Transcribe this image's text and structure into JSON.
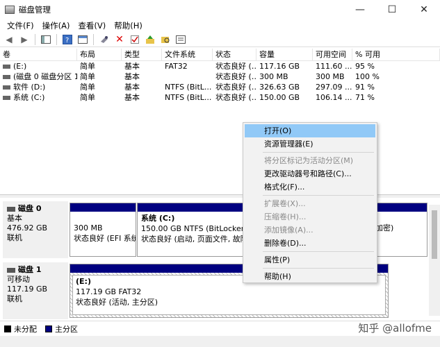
{
  "window": {
    "title": "磁盘管理",
    "min": "—",
    "max": "☐",
    "close": "✕"
  },
  "menu": [
    "文件(F)",
    "操作(A)",
    "查看(V)",
    "帮助(H)"
  ],
  "table": {
    "headers": [
      "卷",
      "布局",
      "类型",
      "文件系统",
      "状态",
      "容量",
      "可用空间",
      "% 可用"
    ],
    "rows": [
      [
        "(E:)",
        "简单",
        "基本",
        "FAT32",
        "状态良好 (…",
        "117.16 GB",
        "111.60 ...",
        "95 %"
      ],
      [
        "(磁盘 0 磁盘分区 1)",
        "简单",
        "基本",
        "",
        "状态良好 (…",
        "300 MB",
        "300 MB",
        "100 %"
      ],
      [
        "软件 (D:)",
        "简单",
        "基本",
        "NTFS (BitL...",
        "状态良好 (…",
        "326.63 GB",
        "297.09 ...",
        "91 %"
      ],
      [
        "系统 (C:)",
        "简单",
        "基本",
        "NTFS (BitL...",
        "状态良好 (…",
        "150.00 GB",
        "106.14 ...",
        "71 %"
      ]
    ]
  },
  "disks": [
    {
      "name": "磁盘 0",
      "type": "基本",
      "size": "476.92 GB",
      "status": "联机",
      "partitions": [
        {
          "line1": "300 MB",
          "line2": "状态良好 (EFI 系统"
        },
        {
          "line1": "系统  (C:)",
          "line2": "150.00 GB NTFS (BitLocker 已加",
          "line3": "状态良好 (启动, 页面文件, 故障转"
        },
        {
          "line1": "",
          "line2": "加密)",
          "line3": ""
        }
      ]
    },
    {
      "name": "磁盘 1",
      "type": "可移动",
      "size": "117.19 GB",
      "status": "联机",
      "partitions": [
        {
          "line1": "(E:)",
          "line2": "117.19 GB FAT32",
          "line3": "状态良好 (活动, 主分区)"
        }
      ]
    }
  ],
  "legend": {
    "unallocated": "未分配",
    "primary": "主分区",
    "unallocated_color": "#000000",
    "primary_color": "#000080"
  },
  "context_menu": {
    "items": [
      "打开(O)",
      "资源管理器(E)",
      "将分区标记为活动分区(M)",
      "更改驱动器号和路径(C)...",
      "格式化(F)...",
      "扩展卷(X)...",
      "压缩卷(H)...",
      "添加镜像(A)...",
      "删除卷(D)...",
      "属性(P)",
      "帮助(H)"
    ]
  },
  "watermark": "知乎 @allofme",
  "colors": {
    "partition_bar": "#000080",
    "menu_highlight": "#91c9f7"
  }
}
